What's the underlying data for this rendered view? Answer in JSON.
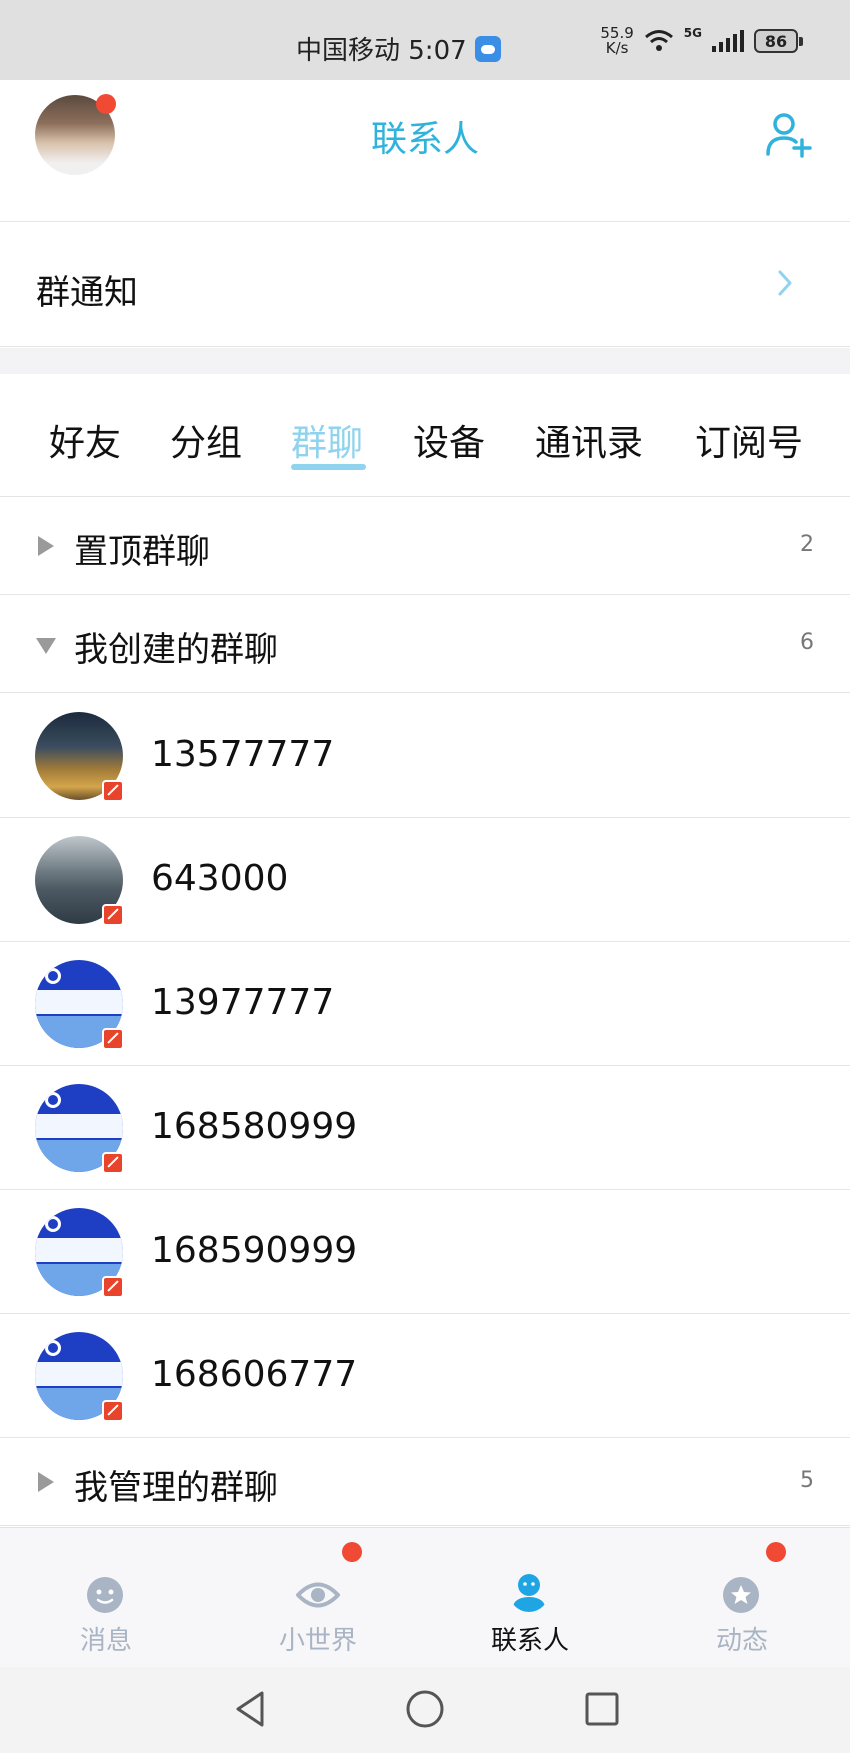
{
  "status_bar": {
    "carrier_time": "中国移动 5:07",
    "net_speed_value": "55.9",
    "net_speed_unit": "K/s",
    "network_type": "5G",
    "battery": "86"
  },
  "header": {
    "title": "联系人",
    "avatar_has_notification": true
  },
  "group_notice": {
    "label": "群通知"
  },
  "tabs": [
    {
      "label": "好友",
      "active": false
    },
    {
      "label": "分组",
      "active": false
    },
    {
      "label": "群聊",
      "active": true
    },
    {
      "label": "设备",
      "active": false
    },
    {
      "label": "通讯录",
      "active": false
    },
    {
      "label": "订阅号",
      "active": false
    }
  ],
  "sections": {
    "pinned": {
      "label": "置顶群聊",
      "count": "2",
      "expanded": false
    },
    "created": {
      "label": "我创建的群聊",
      "count": "6",
      "expanded": true
    },
    "managed": {
      "label": "我管理的群聊",
      "count": "5",
      "expanded": false
    }
  },
  "groups": [
    {
      "name": "13577777",
      "avatar": "night-bridge-photo"
    },
    {
      "name": "643000",
      "avatar": "gate-road-photo"
    },
    {
      "name": "13977777",
      "avatar": "china-telecom-card"
    },
    {
      "name": "168580999",
      "avatar": "china-telecom-card"
    },
    {
      "name": "168590999",
      "avatar": "china-telecom-card"
    },
    {
      "name": "168606777",
      "avatar": "china-telecom-card"
    }
  ],
  "bottom_nav": [
    {
      "label": "消息",
      "icon": "message-face-icon",
      "active": false,
      "dot": false
    },
    {
      "label": "小世界",
      "icon": "eye-icon",
      "active": false,
      "dot": true
    },
    {
      "label": "联系人",
      "icon": "contact-person-icon",
      "active": true,
      "dot": false
    },
    {
      "label": "动态",
      "icon": "star-circle-icon",
      "active": false,
      "dot": true
    }
  ],
  "colors": {
    "accent": "#2fb3dd",
    "active_tab": "#8fd3ee",
    "nav_inactive": "#a9b4c4",
    "nav_active": "#1fa5e3",
    "notification_red": "#f04a35",
    "mute_badge": "#e8432b"
  }
}
